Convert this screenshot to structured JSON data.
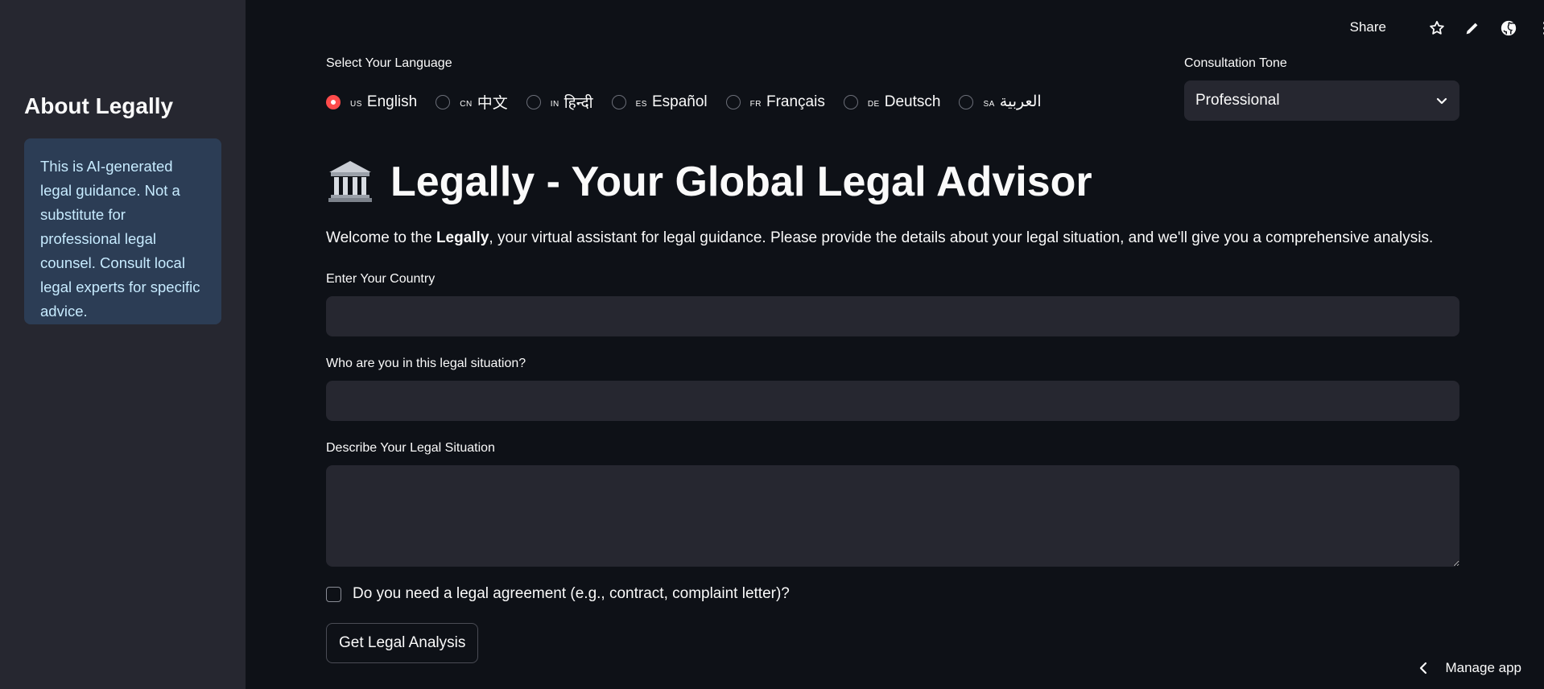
{
  "sidebar": {
    "title": "About Legally",
    "info": "This is AI-generated legal guidance. Not a substitute for professional legal counsel. Consult local legal experts for specific advice."
  },
  "toolbar": {
    "share_label": "Share",
    "icons": [
      "star-icon",
      "pencil-icon",
      "github-icon",
      "more-vertical-icon"
    ]
  },
  "language": {
    "label": "Select Your Language",
    "selected": "English",
    "options": [
      {
        "code": "US",
        "label": "English"
      },
      {
        "code": "CN",
        "label": "中文"
      },
      {
        "code": "IN",
        "label": "हिन्दी"
      },
      {
        "code": "ES",
        "label": "Español"
      },
      {
        "code": "FR",
        "label": "Français"
      },
      {
        "code": "DE",
        "label": "Deutsch"
      },
      {
        "code": "SA",
        "label": "العربية"
      }
    ]
  },
  "tone": {
    "label": "Consultation Tone",
    "value": "Professional"
  },
  "header": {
    "title": "Legally - Your Global Legal Advisor",
    "welcome_pre": "Welcome to the ",
    "welcome_bold": "Legally",
    "welcome_post": ", your virtual assistant for legal guidance. Please provide the details about your legal situation, and we'll give you a comprehensive analysis."
  },
  "form": {
    "country_label": "Enter Your Country",
    "country_value": "",
    "role_label": "Who are you in this legal situation?",
    "role_value": "",
    "situation_label": "Describe Your Legal Situation",
    "situation_value": "",
    "agreement_label": "Do you need a legal agreement (e.g., contract, complaint letter)?",
    "submit_label": "Get Legal Analysis"
  },
  "footer": {
    "manage_label": "Manage app"
  },
  "colors": {
    "background": "#0e1117",
    "sidebar": "#262730",
    "accent": "#ff4b4b",
    "info_box": "#2c3d55"
  }
}
